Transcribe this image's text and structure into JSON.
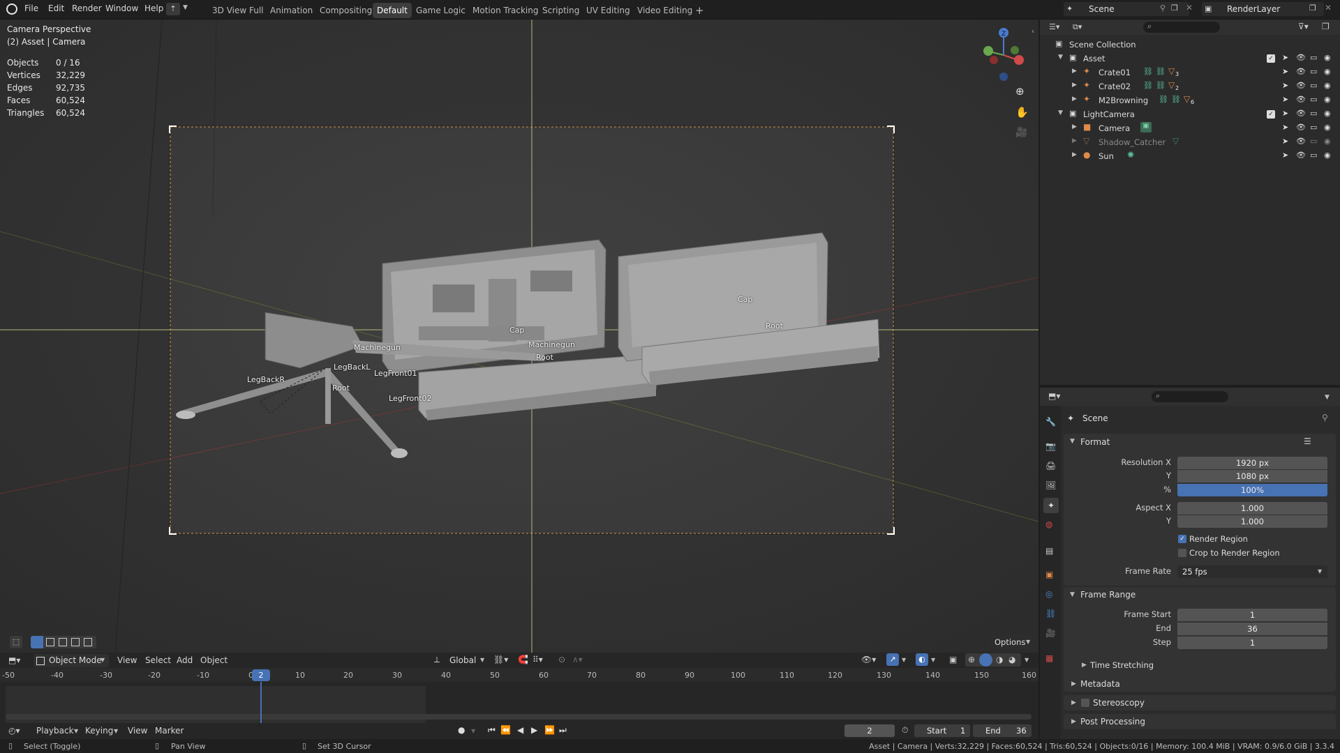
{
  "menu": {
    "items": [
      "File",
      "Edit",
      "Render",
      "Window",
      "Help"
    ]
  },
  "workspaces": {
    "tabs": [
      "3D View Full",
      "Animation",
      "Compositing",
      "Default",
      "Game Logic",
      "Motion Tracking",
      "Scripting",
      "UV Editing",
      "Video Editing"
    ],
    "active": "Default",
    "add": "+"
  },
  "top_right": {
    "scene_name": "Scene",
    "render_layer": "RenderLayer"
  },
  "viewport": {
    "view_name": "Camera Perspective",
    "context": "(2) Asset | Camera",
    "stats": {
      "objects_label": "Objects",
      "objects_value": "0 / 16",
      "vertices_label": "Vertices",
      "vertices_value": "32,229",
      "edges_label": "Edges",
      "edges_value": "92,735",
      "faces_label": "Faces",
      "faces_value": "60,524",
      "triangles_label": "Triangles",
      "triangles_value": "60,524"
    },
    "bone_labels": [
      "Cap",
      "Machinegun",
      "Root",
      "Cap",
      "Root",
      "Machinegun",
      "LegBackL",
      "LegBackR",
      "LegFront01",
      "Root",
      "LegFront02"
    ],
    "options_label": "Options"
  },
  "viewport_header": {
    "mode": "Object Mode",
    "menus": [
      "View",
      "Select",
      "Add",
      "Object"
    ],
    "transform_orientation": "Global"
  },
  "timeline": {
    "ticks": [
      "-50",
      "-40",
      "-30",
      "-20",
      "-10",
      "0",
      "10",
      "20",
      "30",
      "40",
      "50",
      "60",
      "70",
      "80",
      "90",
      "100",
      "110",
      "120",
      "130",
      "140",
      "150",
      "160"
    ],
    "current_frame": "2",
    "menus": [
      "Playback",
      "Keying",
      "View",
      "Marker"
    ],
    "frame_field": "2",
    "start_label": "Start",
    "start_value": "1",
    "end_label": "End",
    "end_value": "36"
  },
  "outliner": {
    "root": "Scene Collection",
    "rows": [
      {
        "name": "Asset"
      },
      {
        "name": "Crate01"
      },
      {
        "name": "Crate02"
      },
      {
        "name": "M2Browning"
      },
      {
        "name": "LightCamera"
      },
      {
        "name": "Camera"
      },
      {
        "name": "Shadow_Catcher"
      },
      {
        "name": "Sun"
      }
    ],
    "badges": [
      "3",
      "2",
      "6"
    ]
  },
  "properties": {
    "context": "Scene",
    "format_header": "Format",
    "resolution_x_label": "Resolution X",
    "resolution_x": "1920 px",
    "resolution_y_label": "Y",
    "resolution_y": "1080 px",
    "percent_label": "%",
    "percent": "100%",
    "aspect_x_label": "Aspect X",
    "aspect_x": "1.000",
    "aspect_y_label": "Y",
    "aspect_y": "1.000",
    "render_region": "Render Region",
    "crop_region": "Crop to Render Region",
    "frame_rate_label": "Frame Rate",
    "frame_rate": "25 fps",
    "frame_range_header": "Frame Range",
    "frame_start_label": "Frame Start",
    "frame_start": "1",
    "end_label": "End",
    "end": "36",
    "step_label": "Step",
    "step": "1",
    "time_stretching": "Time Stretching",
    "metadata": "Metadata",
    "stereoscopy": "Stereoscopy",
    "post_processing": "Post Processing"
  },
  "statusbar": {
    "select": "Select (Toggle)",
    "pan": "Pan View",
    "cursor": "Set 3D Cursor",
    "info": "Asset | Camera | Verts:32,229 | Faces:60,524 | Tris:60,524 | Objects:0/16 | Memory: 100.4 MiB | VRAM: 0.9/6.0 GiB | 3.3.4"
  },
  "colors": {
    "accent_blue": "#4772b3",
    "playhead": "#4772b3",
    "region_border": "#e09a4a"
  }
}
